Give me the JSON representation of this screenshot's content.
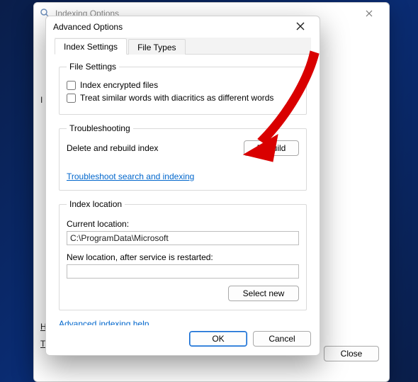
{
  "parent": {
    "title": "Indexing Options",
    "close_label": "Close"
  },
  "modal": {
    "title": "Advanced Options",
    "tabs": {
      "settings": "Index Settings",
      "filetypes": "File Types"
    },
    "file_settings": {
      "legend": "File Settings",
      "encrypt_label": "Index encrypted files",
      "diacritics_label": "Treat similar words with diacritics as different words"
    },
    "troubleshooting": {
      "legend": "Troubleshooting",
      "rebuild_text": "Delete and rebuild index",
      "rebuild_button": "Rebuild",
      "tshoot_link": "Troubleshoot search and indexing"
    },
    "index_location": {
      "legend": "Index location",
      "current_label": "Current location:",
      "current_value": "C:\\ProgramData\\Microsoft",
      "new_label": "New location, after service is restarted:",
      "new_value": "",
      "select_button": "Select new"
    },
    "help_link": "Advanced indexing help",
    "ok": "OK",
    "cancel": "Cancel"
  }
}
